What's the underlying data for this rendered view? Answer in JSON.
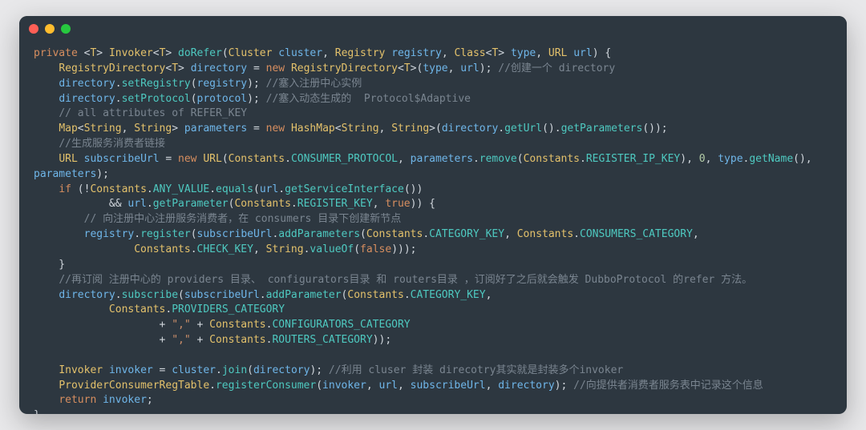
{
  "code": {
    "lines": [
      [
        {
          "c": "kw",
          "t": "private"
        },
        {
          "c": "pu",
          "t": " <"
        },
        {
          "c": "ty",
          "t": "T"
        },
        {
          "c": "pu",
          "t": "> "
        },
        {
          "c": "ty",
          "t": "Invoker"
        },
        {
          "c": "pu",
          "t": "<"
        },
        {
          "c": "ty",
          "t": "T"
        },
        {
          "c": "pu",
          "t": "> "
        },
        {
          "c": "fn",
          "t": "doRefer"
        },
        {
          "c": "pu",
          "t": "("
        },
        {
          "c": "ty",
          "t": "Cluster"
        },
        {
          "c": "pu",
          "t": " "
        },
        {
          "c": "lv",
          "t": "cluster"
        },
        {
          "c": "pu",
          "t": ", "
        },
        {
          "c": "ty",
          "t": "Registry"
        },
        {
          "c": "pu",
          "t": " "
        },
        {
          "c": "lv",
          "t": "registry"
        },
        {
          "c": "pu",
          "t": ", "
        },
        {
          "c": "ty",
          "t": "Class"
        },
        {
          "c": "pu",
          "t": "<"
        },
        {
          "c": "ty",
          "t": "T"
        },
        {
          "c": "pu",
          "t": "> "
        },
        {
          "c": "lv",
          "t": "type"
        },
        {
          "c": "pu",
          "t": ", "
        },
        {
          "c": "ty",
          "t": "URL"
        },
        {
          "c": "pu",
          "t": " "
        },
        {
          "c": "lv",
          "t": "url"
        },
        {
          "c": "pu",
          "t": ") {"
        }
      ],
      [
        {
          "c": "pu",
          "t": "    "
        },
        {
          "c": "ty",
          "t": "RegistryDirectory"
        },
        {
          "c": "pu",
          "t": "<"
        },
        {
          "c": "ty",
          "t": "T"
        },
        {
          "c": "pu",
          "t": "> "
        },
        {
          "c": "lv",
          "t": "directory"
        },
        {
          "c": "pu",
          "t": " = "
        },
        {
          "c": "kw",
          "t": "new"
        },
        {
          "c": "pu",
          "t": " "
        },
        {
          "c": "ty",
          "t": "RegistryDirectory"
        },
        {
          "c": "pu",
          "t": "<"
        },
        {
          "c": "ty",
          "t": "T"
        },
        {
          "c": "pu",
          "t": ">("
        },
        {
          "c": "lv",
          "t": "type"
        },
        {
          "c": "pu",
          "t": ", "
        },
        {
          "c": "lv",
          "t": "url"
        },
        {
          "c": "pu",
          "t": "); "
        },
        {
          "c": "cm",
          "t": "//创建一个 directory"
        }
      ],
      [
        {
          "c": "pu",
          "t": "    "
        },
        {
          "c": "lv",
          "t": "directory"
        },
        {
          "c": "pu",
          "t": "."
        },
        {
          "c": "fn",
          "t": "setRegistry"
        },
        {
          "c": "pu",
          "t": "("
        },
        {
          "c": "lv",
          "t": "registry"
        },
        {
          "c": "pu",
          "t": "); "
        },
        {
          "c": "cm",
          "t": "//塞入注册中心实例"
        }
      ],
      [
        {
          "c": "pu",
          "t": "    "
        },
        {
          "c": "lv",
          "t": "directory"
        },
        {
          "c": "pu",
          "t": "."
        },
        {
          "c": "fn",
          "t": "setProtocol"
        },
        {
          "c": "pu",
          "t": "("
        },
        {
          "c": "lv",
          "t": "protocol"
        },
        {
          "c": "pu",
          "t": "); "
        },
        {
          "c": "cm",
          "t": "//塞入动态生成的  Protocol$Adaptive"
        }
      ],
      [
        {
          "c": "pu",
          "t": "    "
        },
        {
          "c": "cm",
          "t": "// all attributes of REFER_KEY"
        }
      ],
      [
        {
          "c": "pu",
          "t": "    "
        },
        {
          "c": "ty",
          "t": "Map"
        },
        {
          "c": "pu",
          "t": "<"
        },
        {
          "c": "ty",
          "t": "String"
        },
        {
          "c": "pu",
          "t": ", "
        },
        {
          "c": "ty",
          "t": "String"
        },
        {
          "c": "pu",
          "t": "> "
        },
        {
          "c": "lv",
          "t": "parameters"
        },
        {
          "c": "pu",
          "t": " = "
        },
        {
          "c": "kw",
          "t": "new"
        },
        {
          "c": "pu",
          "t": " "
        },
        {
          "c": "ty",
          "t": "HashMap"
        },
        {
          "c": "pu",
          "t": "<"
        },
        {
          "c": "ty",
          "t": "String"
        },
        {
          "c": "pu",
          "t": ", "
        },
        {
          "c": "ty",
          "t": "String"
        },
        {
          "c": "pu",
          "t": ">("
        },
        {
          "c": "lv",
          "t": "directory"
        },
        {
          "c": "pu",
          "t": "."
        },
        {
          "c": "fn",
          "t": "getUrl"
        },
        {
          "c": "pu",
          "t": "()."
        },
        {
          "c": "fn",
          "t": "getParameters"
        },
        {
          "c": "pu",
          "t": "());"
        }
      ],
      [
        {
          "c": "pu",
          "t": "    "
        },
        {
          "c": "cm",
          "t": "//生成服务消费者链接"
        }
      ],
      [
        {
          "c": "pu",
          "t": "    "
        },
        {
          "c": "ty",
          "t": "URL"
        },
        {
          "c": "pu",
          "t": " "
        },
        {
          "c": "lv",
          "t": "subscribeUrl"
        },
        {
          "c": "pu",
          "t": " = "
        },
        {
          "c": "kw",
          "t": "new"
        },
        {
          "c": "pu",
          "t": " "
        },
        {
          "c": "ty",
          "t": "URL"
        },
        {
          "c": "pu",
          "t": "("
        },
        {
          "c": "ty",
          "t": "Constants"
        },
        {
          "c": "pu",
          "t": "."
        },
        {
          "c": "ct",
          "t": "CONSUMER_PROTOCOL"
        },
        {
          "c": "pu",
          "t": ", "
        },
        {
          "c": "lv",
          "t": "parameters"
        },
        {
          "c": "pu",
          "t": "."
        },
        {
          "c": "fn",
          "t": "remove"
        },
        {
          "c": "pu",
          "t": "("
        },
        {
          "c": "ty",
          "t": "Constants"
        },
        {
          "c": "pu",
          "t": "."
        },
        {
          "c": "ct",
          "t": "REGISTER_IP_KEY"
        },
        {
          "c": "pu",
          "t": "), "
        },
        {
          "c": "nu",
          "t": "0"
        },
        {
          "c": "pu",
          "t": ", "
        },
        {
          "c": "lv",
          "t": "type"
        },
        {
          "c": "pu",
          "t": "."
        },
        {
          "c": "fn",
          "t": "getName"
        },
        {
          "c": "pu",
          "t": "(), "
        }
      ],
      [
        {
          "c": "lv",
          "t": "parameters"
        },
        {
          "c": "pu",
          "t": ");"
        }
      ],
      [
        {
          "c": "pu",
          "t": "    "
        },
        {
          "c": "kw",
          "t": "if"
        },
        {
          "c": "pu",
          "t": " (!"
        },
        {
          "c": "ty",
          "t": "Constants"
        },
        {
          "c": "pu",
          "t": "."
        },
        {
          "c": "ct",
          "t": "ANY_VALUE"
        },
        {
          "c": "pu",
          "t": "."
        },
        {
          "c": "fn",
          "t": "equals"
        },
        {
          "c": "pu",
          "t": "("
        },
        {
          "c": "lv",
          "t": "url"
        },
        {
          "c": "pu",
          "t": "."
        },
        {
          "c": "fn",
          "t": "getServiceInterface"
        },
        {
          "c": "pu",
          "t": "())"
        }
      ],
      [
        {
          "c": "pu",
          "t": "            && "
        },
        {
          "c": "lv",
          "t": "url"
        },
        {
          "c": "pu",
          "t": "."
        },
        {
          "c": "fn",
          "t": "getParameter"
        },
        {
          "c": "pu",
          "t": "("
        },
        {
          "c": "ty",
          "t": "Constants"
        },
        {
          "c": "pu",
          "t": "."
        },
        {
          "c": "ct",
          "t": "REGISTER_KEY"
        },
        {
          "c": "pu",
          "t": ", "
        },
        {
          "c": "kw",
          "t": "true"
        },
        {
          "c": "pu",
          "t": ")) {"
        }
      ],
      [
        {
          "c": "pu",
          "t": "        "
        },
        {
          "c": "cm",
          "t": "// 向注册中心注册服务消费者，在 consumers 目录下创建新节点"
        }
      ],
      [
        {
          "c": "pu",
          "t": "        "
        },
        {
          "c": "lv",
          "t": "registry"
        },
        {
          "c": "pu",
          "t": "."
        },
        {
          "c": "fn",
          "t": "register"
        },
        {
          "c": "pu",
          "t": "("
        },
        {
          "c": "lv",
          "t": "subscribeUrl"
        },
        {
          "c": "pu",
          "t": "."
        },
        {
          "c": "fn",
          "t": "addParameters"
        },
        {
          "c": "pu",
          "t": "("
        },
        {
          "c": "ty",
          "t": "Constants"
        },
        {
          "c": "pu",
          "t": "."
        },
        {
          "c": "ct",
          "t": "CATEGORY_KEY"
        },
        {
          "c": "pu",
          "t": ", "
        },
        {
          "c": "ty",
          "t": "Constants"
        },
        {
          "c": "pu",
          "t": "."
        },
        {
          "c": "ct",
          "t": "CONSUMERS_CATEGORY"
        },
        {
          "c": "pu",
          "t": ","
        }
      ],
      [
        {
          "c": "pu",
          "t": "                "
        },
        {
          "c": "ty",
          "t": "Constants"
        },
        {
          "c": "pu",
          "t": "."
        },
        {
          "c": "ct",
          "t": "CHECK_KEY"
        },
        {
          "c": "pu",
          "t": ", "
        },
        {
          "c": "ty",
          "t": "String"
        },
        {
          "c": "pu",
          "t": "."
        },
        {
          "c": "fn",
          "t": "valueOf"
        },
        {
          "c": "pu",
          "t": "("
        },
        {
          "c": "kw",
          "t": "false"
        },
        {
          "c": "pu",
          "t": ")));"
        }
      ],
      [
        {
          "c": "pu",
          "t": "    }"
        }
      ],
      [
        {
          "c": "pu",
          "t": "    "
        },
        {
          "c": "cm",
          "t": "//再订阅 注册中心的 providers 目录、 configurators目录 和 routers目录 ，订阅好了之后就会触发 DubboProtocol 的refer 方法。"
        }
      ],
      [
        {
          "c": "pu",
          "t": "    "
        },
        {
          "c": "lv",
          "t": "directory"
        },
        {
          "c": "pu",
          "t": "."
        },
        {
          "c": "fn",
          "t": "subscribe"
        },
        {
          "c": "pu",
          "t": "("
        },
        {
          "c": "lv",
          "t": "subscribeUrl"
        },
        {
          "c": "pu",
          "t": "."
        },
        {
          "c": "fn",
          "t": "addParameter"
        },
        {
          "c": "pu",
          "t": "("
        },
        {
          "c": "ty",
          "t": "Constants"
        },
        {
          "c": "pu",
          "t": "."
        },
        {
          "c": "ct",
          "t": "CATEGORY_KEY"
        },
        {
          "c": "pu",
          "t": ","
        }
      ],
      [
        {
          "c": "pu",
          "t": "            "
        },
        {
          "c": "ty",
          "t": "Constants"
        },
        {
          "c": "pu",
          "t": "."
        },
        {
          "c": "ct",
          "t": "PROVIDERS_CATEGORY"
        }
      ],
      [
        {
          "c": "pu",
          "t": "                    + "
        },
        {
          "c": "st",
          "t": "\",\""
        },
        {
          "c": "pu",
          "t": " + "
        },
        {
          "c": "ty",
          "t": "Constants"
        },
        {
          "c": "pu",
          "t": "."
        },
        {
          "c": "ct",
          "t": "CONFIGURATORS_CATEGORY"
        }
      ],
      [
        {
          "c": "pu",
          "t": "                    + "
        },
        {
          "c": "st",
          "t": "\",\""
        },
        {
          "c": "pu",
          "t": " + "
        },
        {
          "c": "ty",
          "t": "Constants"
        },
        {
          "c": "pu",
          "t": "."
        },
        {
          "c": "ct",
          "t": "ROUTERS_CATEGORY"
        },
        {
          "c": "pu",
          "t": "));"
        }
      ],
      [
        {
          "c": "pu",
          "t": ""
        }
      ],
      [
        {
          "c": "pu",
          "t": "    "
        },
        {
          "c": "ty",
          "t": "Invoker"
        },
        {
          "c": "pu",
          "t": " "
        },
        {
          "c": "lv",
          "t": "invoker"
        },
        {
          "c": "pu",
          "t": " = "
        },
        {
          "c": "lv",
          "t": "cluster"
        },
        {
          "c": "pu",
          "t": "."
        },
        {
          "c": "fn",
          "t": "join"
        },
        {
          "c": "pu",
          "t": "("
        },
        {
          "c": "lv",
          "t": "directory"
        },
        {
          "c": "pu",
          "t": "); "
        },
        {
          "c": "cm",
          "t": "//利用 cluser 封装 direcotry其实就是封装多个invoker"
        }
      ],
      [
        {
          "c": "pu",
          "t": "    "
        },
        {
          "c": "ty",
          "t": "ProviderConsumerRegTable"
        },
        {
          "c": "pu",
          "t": "."
        },
        {
          "c": "fn",
          "t": "registerConsumer"
        },
        {
          "c": "pu",
          "t": "("
        },
        {
          "c": "lv",
          "t": "invoker"
        },
        {
          "c": "pu",
          "t": ", "
        },
        {
          "c": "lv",
          "t": "url"
        },
        {
          "c": "pu",
          "t": ", "
        },
        {
          "c": "lv",
          "t": "subscribeUrl"
        },
        {
          "c": "pu",
          "t": ", "
        },
        {
          "c": "lv",
          "t": "directory"
        },
        {
          "c": "pu",
          "t": "); "
        },
        {
          "c": "cm",
          "t": "//向提供者消费者服务表中记录这个信息"
        }
      ],
      [
        {
          "c": "pu",
          "t": "    "
        },
        {
          "c": "kw",
          "t": "return"
        },
        {
          "c": "pu",
          "t": " "
        },
        {
          "c": "lv",
          "t": "invoker"
        },
        {
          "c": "pu",
          "t": ";"
        }
      ],
      [
        {
          "c": "pu",
          "t": "}"
        }
      ]
    ]
  }
}
